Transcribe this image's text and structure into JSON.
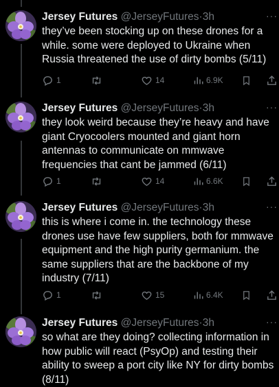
{
  "tweets": [
    {
      "author": "Jersey Futures",
      "handle": "@JerseyFutures",
      "separator": "·",
      "time": "3h",
      "more": "···",
      "text": "they’ve been stocking up on these drones for a while. some were deployed to Ukraine when Russia threatened the use of dirty bombs (5/11)",
      "replies": "1",
      "retweets": "",
      "likes": "14",
      "views": "6.9K"
    },
    {
      "author": "Jersey Futures",
      "handle": "@JerseyFutures",
      "separator": "·",
      "time": "3h",
      "more": "···",
      "text": "they look weird because they’re heavy and have giant Cryocoolers mounted and giant horn antennas to communicate on mmwave frequencies that cant be jammed (6/11)",
      "replies": "1",
      "retweets": "",
      "likes": "14",
      "views": "6.6K"
    },
    {
      "author": "Jersey Futures",
      "handle": "@JerseyFutures",
      "separator": "·",
      "time": "3h",
      "more": "···",
      "text": "this is where i come in. the technology these drones use have few suppliers, both for mmwave equipment and the high purity germanium. the same suppliers that are the backbone of my industry (7/11)",
      "replies": "1",
      "retweets": "",
      "likes": "15",
      "views": "6.4K"
    },
    {
      "author": "Jersey Futures",
      "handle": "@JerseyFutures",
      "separator": "·",
      "time": "3h",
      "more": "···",
      "text": "so what are they doing? collecting information in how public will react (PsyOp) and testing their ability to sweep a port city like NY for dirty bombs (8/11)"
    }
  ],
  "icons": {
    "reply": "reply-icon",
    "retweet": "retweet-icon",
    "like": "heart-icon",
    "views": "views-icon",
    "bookmark": "bookmark-icon",
    "share": "share-icon"
  },
  "colors": {
    "background": "#000000",
    "text": "#e7e9ea",
    "muted": "#71767b",
    "thread_line": "#333639"
  }
}
